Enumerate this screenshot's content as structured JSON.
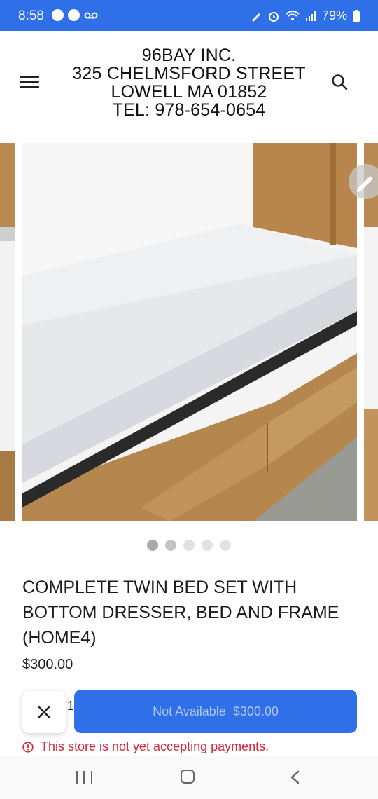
{
  "status_bar": {
    "time": "8:58",
    "battery": "79%",
    "background_color": "#2f6fe8"
  },
  "header": {
    "store_lines": [
      "96BAY INC.",
      "325 CHELMSFORD STREET",
      "LOWELL MA 01852",
      "TEL: 978-654-0654"
    ],
    "menu_icon": "hamburger-menu-icon",
    "search_icon": "search-icon"
  },
  "carousel": {
    "dots_count": 5,
    "active_index": 0,
    "edit_icon": "pencil-icon"
  },
  "product": {
    "title": "COMPLETE TWIN BED SET WITH BOTTOM DRESSER, BED AND FRAME (HOME4)",
    "price": "$300.00"
  },
  "purchase": {
    "quantity": "1",
    "button_label": "Not Available",
    "button_price": "$300.00",
    "accent_color": "#2f6fe8"
  },
  "notice": {
    "text": "This store is not yet accepting payments.",
    "color": "#d6263a"
  },
  "nav_bar": {
    "icons": [
      "recent-apps-icon",
      "home-icon",
      "back-icon"
    ]
  }
}
